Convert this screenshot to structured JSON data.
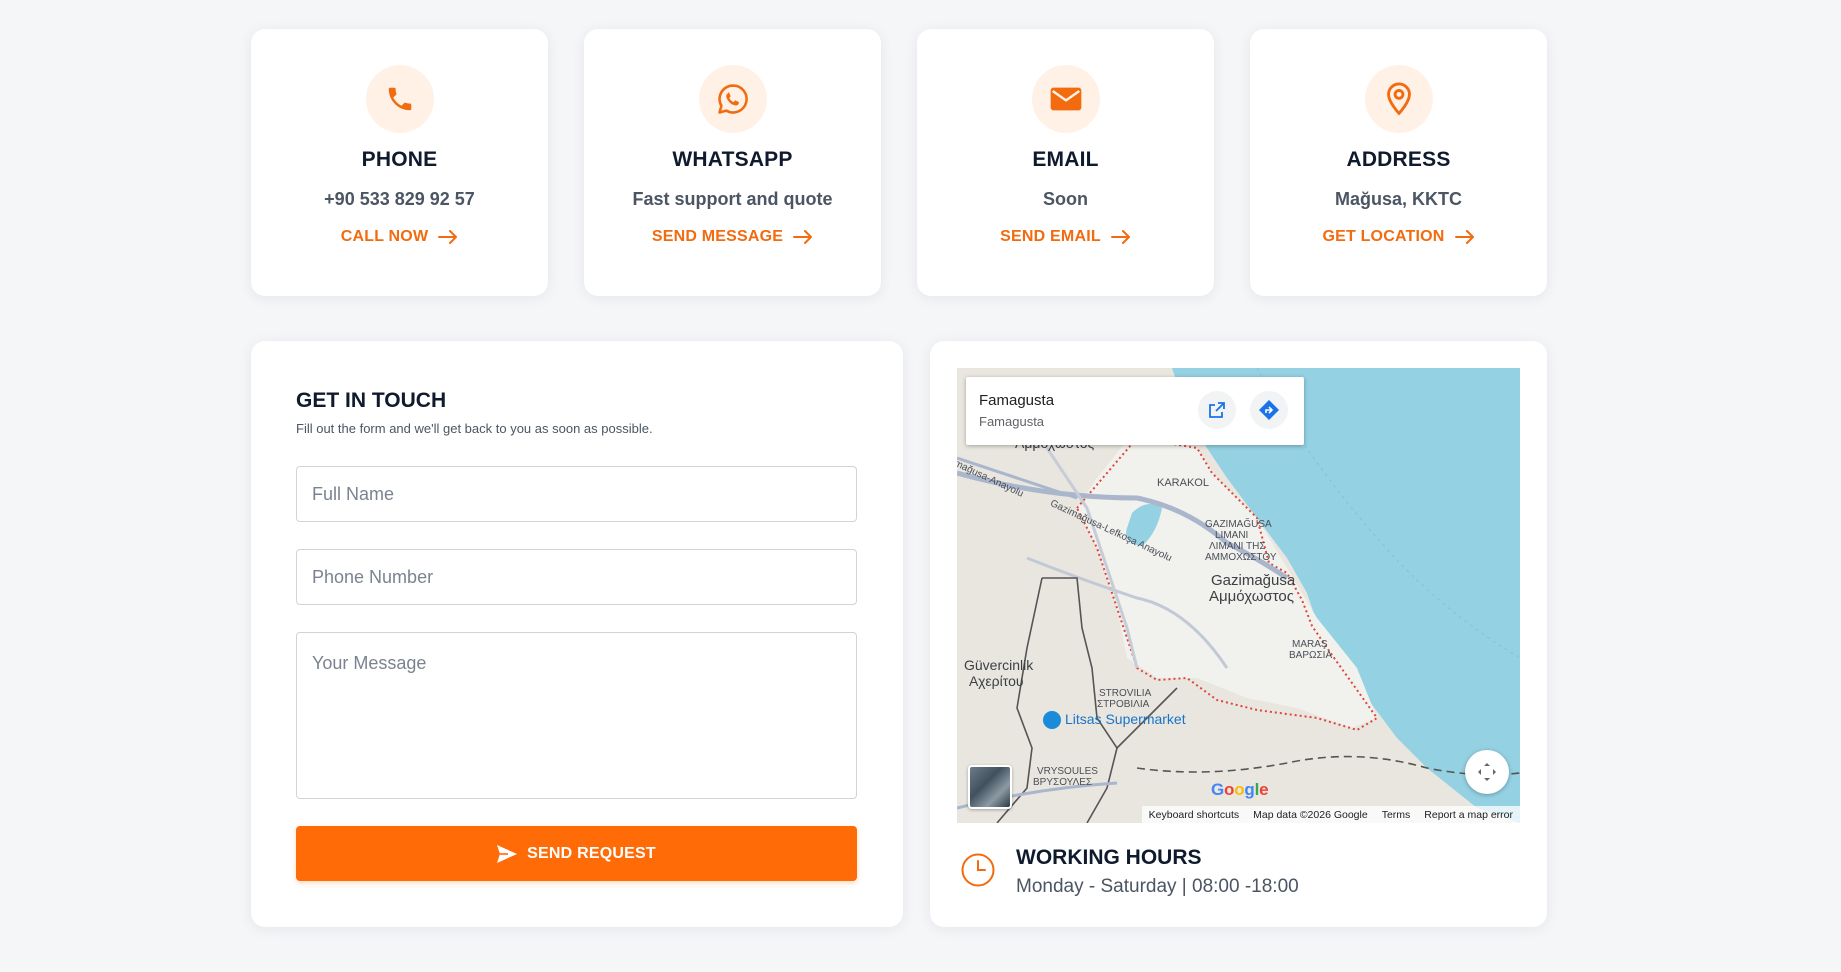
{
  "contact_cards": [
    {
      "title": "PHONE",
      "subtitle": "+90 533 829 92 57",
      "action": "CALL NOW",
      "icon": "phone-icon"
    },
    {
      "title": "WHATSAPP",
      "subtitle": "Fast support and quote",
      "action": "SEND MESSAGE",
      "icon": "whatsapp-icon"
    },
    {
      "title": "EMAIL",
      "subtitle": "Soon",
      "action": "SEND EMAIL",
      "icon": "envelope-icon"
    },
    {
      "title": "ADDRESS",
      "subtitle": "Mağusa, KKTC",
      "action": "GET LOCATION",
      "icon": "map-pin-icon"
    }
  ],
  "form": {
    "title": "GET IN TOUCH",
    "subtitle": "Fill out the form and we'll get back to you as soon as possible.",
    "name_placeholder": "Full Name",
    "phone_placeholder": "Phone Number",
    "message_placeholder": "Your Message",
    "submit_label": "SEND REQUEST"
  },
  "map": {
    "place_name": "Famagusta",
    "place_sub": "Famagusta",
    "brand": "Google",
    "footer": [
      "Keyboard shortcuts",
      "Map data ©2026 Google",
      "Terms",
      "Report a map error"
    ],
    "labels": {
      "karakol": "KARAKOL",
      "port_1": "GAZIMAĞUSA",
      "port_2": "LIMANI",
      "port_3": "ΛΙΜΑΝΙ ΤΗΣ",
      "port_4": "ΑΜΜΟΧΩΣΤΟΥ",
      "city_1": "Gazimağusa",
      "city_2": "Αμμόχωστος",
      "maras_1": "MARAŞ",
      "maras_2": "ΒΑΡΩΣΙΑ",
      "guvercinlik_1": "Güvercinlik",
      "guvercinlik_2": "Αχερίτου",
      "strovilia_1": "STROVILIA",
      "strovilia_2": "ΣΤΡΟΒΙΛΙΑ",
      "supermarket": "Litsas Supermarket",
      "vrysoules_1": "VRYSOULES",
      "vrysoules_2": "ΒΡΥΣΟΥΛΕΣ",
      "road_1": "Gazimağusa-Lefkoşa Anayolu",
      "road_2": "mağusa-Anayolu",
      "top_cut": "Αμμόχωστος"
    },
    "colors": {
      "sea": "#94d1e3",
      "land": "#e8e6df",
      "urban": "#f3f3f1",
      "boundary": "#e0453a",
      "road": "#a9b6cc"
    }
  },
  "hours": {
    "title": "WORKING HOURS",
    "text": "Monday - Saturday | 08:00 -18:00"
  },
  "theme": {
    "accent": "#ff6b06",
    "accent_soft": "#fff1e6"
  }
}
